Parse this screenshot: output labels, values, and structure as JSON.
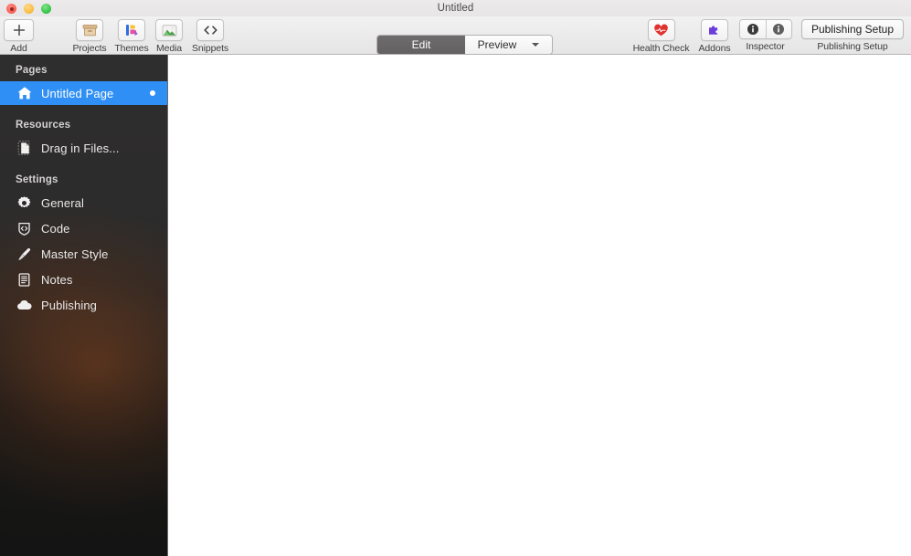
{
  "window": {
    "title": "Untitled",
    "traffic_lights": [
      "close-button",
      "minimize-button",
      "zoom-button"
    ]
  },
  "toolbar": {
    "left_items": [
      {
        "label": "Add",
        "icon": "plus-icon"
      },
      {
        "label": "Projects",
        "icon": "archive-box-icon"
      },
      {
        "label": "Themes",
        "icon": "themes-palette-icon"
      },
      {
        "label": "Media",
        "icon": "photo-icon"
      },
      {
        "label": "Snippets",
        "icon": "code-brackets-icon"
      }
    ],
    "mode_switch": {
      "edit_label": "Edit",
      "preview_label": "Preview",
      "selected": "Edit"
    },
    "right_items": [
      {
        "label": "Health Check",
        "icon": "heart-pulse-icon"
      },
      {
        "label": "Addons",
        "icon": "puzzle-piece-icon"
      },
      {
        "label": "Inspector",
        "icon": "info-circle-icon"
      }
    ],
    "publishing": {
      "button_label": "Publishing Setup",
      "caption_label": "Publishing Setup"
    }
  },
  "sidebar": {
    "sections": [
      {
        "header": "Pages",
        "items": [
          {
            "label": "Untitled Page",
            "icon": "home-icon",
            "selected": true,
            "badge": "unsaved-dot"
          }
        ]
      },
      {
        "header": "Resources",
        "items": [
          {
            "label": "Drag in Files...",
            "icon": "document-drop-icon",
            "selected": false
          }
        ]
      },
      {
        "header": "Settings",
        "items": [
          {
            "label": "General",
            "icon": "gear-icon",
            "selected": false
          },
          {
            "label": "Code",
            "icon": "shield-code-icon",
            "selected": false
          },
          {
            "label": "Master Style",
            "icon": "paintbrush-icon",
            "selected": false
          },
          {
            "label": "Notes",
            "icon": "notes-lines-icon",
            "selected": false
          },
          {
            "label": "Publishing",
            "icon": "cloud-icon",
            "selected": false
          }
        ]
      }
    ]
  },
  "colors": {
    "selection_blue": "#2f8ff5",
    "sidebar_dark": "#2e2d2d",
    "toolbar_gray": "#eceaea",
    "canvas_white": "#ffffff"
  }
}
